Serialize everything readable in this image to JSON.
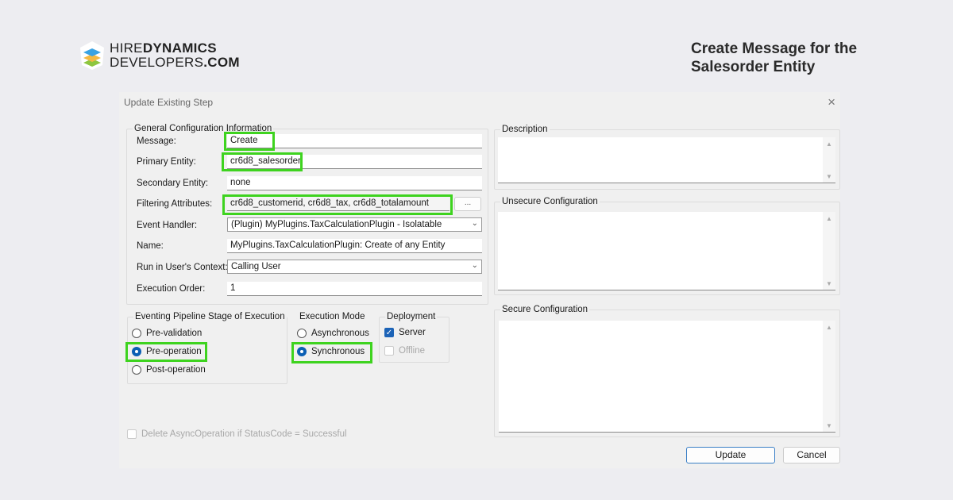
{
  "brand": {
    "line1_light": "HIRE",
    "line1_bold": "DYNAMICS",
    "line2_light": "DEVELOPERS",
    "line2_bold": ".COM",
    "logo_icon": "stacked-layers-icon"
  },
  "headline": {
    "line1": "Create Message for the",
    "line2": "Salesorder Entity"
  },
  "dialog": {
    "title": "Update Existing Step",
    "close_icon": "×",
    "general": {
      "label": "General Configuration Information",
      "fields": [
        {
          "label": "Message:",
          "value": "Create"
        },
        {
          "label": "Primary Entity:",
          "value": "cr6d8_salesorder"
        },
        {
          "label": "Secondary Entity:",
          "value": "none"
        },
        {
          "label": "Filtering Attributes:",
          "value": "cr6d8_customerid, cr6d8_tax, cr6d8_totalamount",
          "button": "..."
        },
        {
          "label": "Event Handler:",
          "value": "(Plugin) MyPlugins.TaxCalculationPlugin - Isolatable"
        },
        {
          "label": "Name:",
          "value": "MyPlugins.TaxCalculationPlugin: Create of any Entity"
        },
        {
          "label": "Run in User's Context:",
          "value": "Calling User"
        },
        {
          "label": "Execution Order:",
          "value": "1"
        }
      ]
    },
    "pipeline": {
      "label": "Eventing Pipeline Stage of Execution",
      "options": [
        "Pre-validation",
        "Pre-operation",
        "Post-operation"
      ],
      "selected": "Pre-operation"
    },
    "mode": {
      "label": "Execution Mode",
      "options": [
        "Asynchronous",
        "Synchronous"
      ],
      "selected": "Synchronous"
    },
    "deployment": {
      "label": "Deployment",
      "server": {
        "label": "Server",
        "checked": true
      },
      "offline": {
        "label": "Offline",
        "checked": false,
        "disabled": true
      }
    },
    "delete_async": {
      "label": "Delete AsyncOperation if StatusCode = Successful",
      "checked": false,
      "disabled": true
    },
    "description": {
      "label": "Description",
      "value": ""
    },
    "unsecure": {
      "label": "Unsecure Configuration",
      "value": ""
    },
    "secure": {
      "label": "Secure Configuration",
      "value": ""
    },
    "buttons": {
      "update": "Update",
      "cancel": "Cancel"
    },
    "highlight_color": "#3ed31f"
  }
}
